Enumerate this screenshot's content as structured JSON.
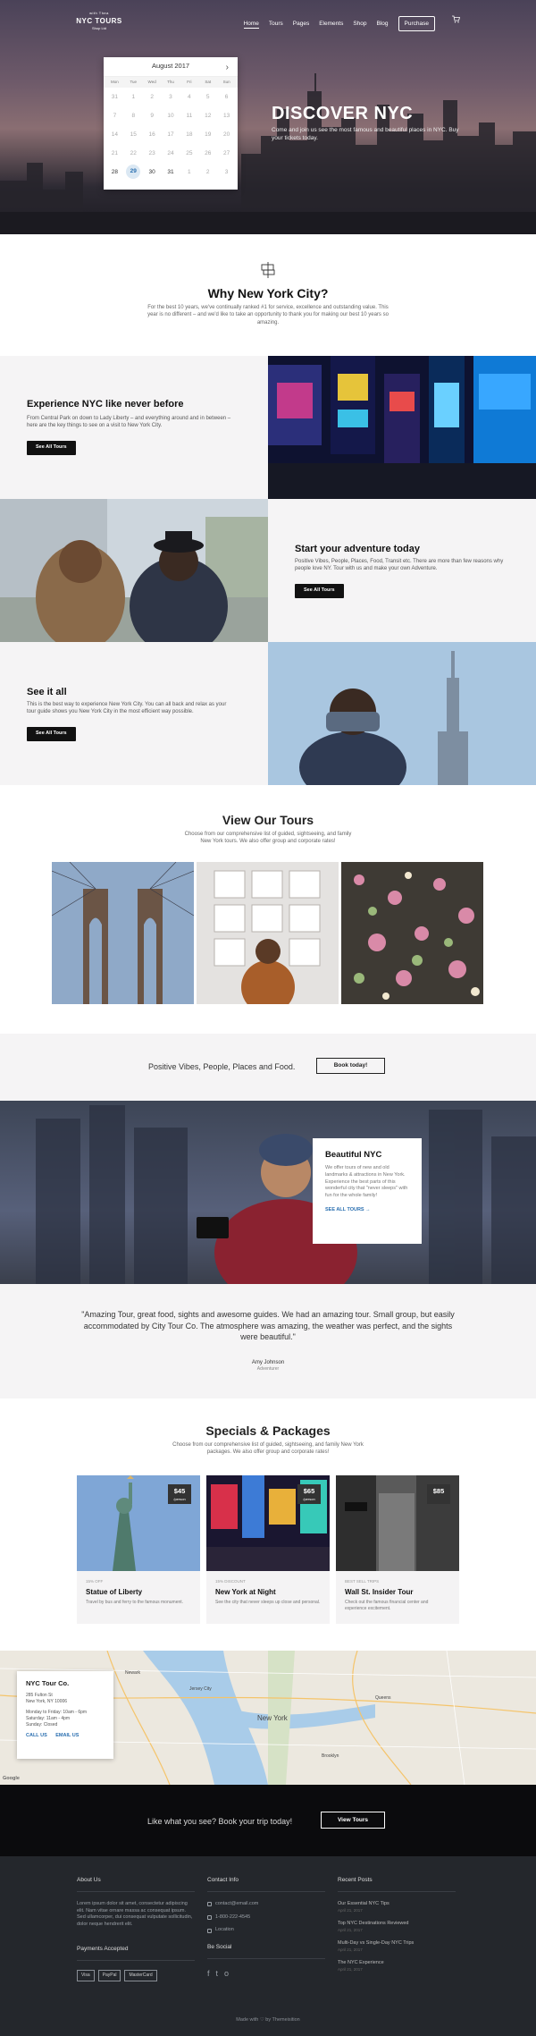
{
  "nav": {
    "logo_top": "with Thea",
    "logo_main": "NYC TOURS",
    "logo_sub": "Shop Ltd",
    "items": [
      "Home",
      "Tours",
      "Pages",
      "Elements",
      "Shop",
      "Blog"
    ],
    "purchase": "Purchase"
  },
  "calendar": {
    "month": "August 2017",
    "days": [
      "Mon",
      "Tue",
      "Wed",
      "Thu",
      "Fri",
      "Sat",
      "Sun"
    ],
    "cells": [
      "31",
      "1",
      "2",
      "3",
      "4",
      "5",
      "6",
      "7",
      "8",
      "9",
      "10",
      "11",
      "12",
      "13",
      "14",
      "15",
      "16",
      "17",
      "18",
      "19",
      "20",
      "21",
      "22",
      "23",
      "24",
      "25",
      "26",
      "27",
      "28",
      "29",
      "30",
      "31",
      "1",
      "2",
      "3"
    ],
    "selected": "29"
  },
  "hero": {
    "title": "DISCOVER NYC",
    "subtitle": "Come and join us see the most famous and beautiful places in NYC. Buy your tickets today."
  },
  "why": {
    "title": "Why New York City?",
    "text": "For the best 10 years, we've continually ranked #1 for service, excellence and outstanding value. This year is no different – and we'd like to take an opportunity to thank you for making our best 10 years so amazing."
  },
  "sections": [
    {
      "title": "Experience NYC like never before",
      "text": "From Central Park on down to Lady Liberty – and everything around and in between – here are the key things to see on a visit to New York City.",
      "button": "See All Tours"
    },
    {
      "title": "Start your adventure today",
      "text": "Positive Vibes, People, Places, Food, Transit etc. There are more than few reasons why people love NY. Tour with us and make your own Adventure.",
      "button": "See All Tours"
    },
    {
      "title": "See it all",
      "text": "This is the best way to experience New York City. You can all back and relax as your tour guide shows you New York City in the most efficient way possible.",
      "button": "See All Tours"
    }
  ],
  "tours": {
    "title": "View Our Tours",
    "text": "Choose from our comprehensive list of guided, sightseeing, and family New York tours. We also offer group and corporate rates!"
  },
  "vibes": {
    "text": "Positive Vibes, People, Places and Food.",
    "button": "Book today!"
  },
  "beautiful": {
    "title": "Beautiful NYC",
    "text": "We offer tours of new and old landmarks & attractions in New York. Experience the best parts of this wonderful city that \"never sleeps\" with fun for the whole family!",
    "link": "SEE ALL TOURS"
  },
  "testimonial": {
    "quote": "\"Amazing Tour, great food, sights and awesome guides. We had an amazing tour. Small group, but easily accommodated by City Tour Co. The atmosphere was amazing, the weather was perfect, and the sights were beautiful.\"",
    "name": "Amy Johnson",
    "role": "Adventurer"
  },
  "specials": {
    "title": "Specials & Packages",
    "text": "Choose from our comprehensive list of guided, sightseeing, and family New York packages. We also offer group and corporate rates!",
    "cards": [
      {
        "price": "$45",
        "per": "/person",
        "category": "15% OFF",
        "title": "Statue of Liberty",
        "text": "Travel by bus and ferry to the famous monument."
      },
      {
        "price": "$65",
        "per": "/person",
        "category": "15% DISCOUNT",
        "title": "New York at Night",
        "text": "See the city that never sleeps up close and personal."
      },
      {
        "price": "$85",
        "per": "",
        "category": "BEST SELL TRIPS",
        "title": "Wall St. Insider Tour",
        "text": "Check out the famous financial center and experience excitement."
      }
    ]
  },
  "map": {
    "title": "NYC Tour Co.",
    "address1": "285 Fulton St",
    "address2": "New York, NY 10006",
    "hours": [
      "Monday to Friday: 10am - 6pm",
      "Saturday: 11am - 4pm",
      "Sunday: Closed"
    ],
    "call": "CALL US",
    "email": "EMAIL US",
    "labels": [
      "Jersey City",
      "New York",
      "Newark",
      "Queens",
      "Brooklyn"
    ],
    "google": "Google"
  },
  "book": {
    "text": "Like what you see? Book your trip today!",
    "button": "View Tours"
  },
  "footer": {
    "about_title": "About Us",
    "about_text": "Lorem ipsum dolor sit amet, consectetur adipiscing elit. Nam vitae ornare massa ac consequat ipsum. Sed ullamcorper, dui consequat vulputate sollicitudin, dolor neque hendrerit elit.",
    "payments_title": "Payments Accepted",
    "payments": [
      "Visa",
      "PayPal",
      "MasterCard"
    ],
    "contact_title": "Contact Info",
    "contact": [
      "contact@email.com",
      "1-800-222-4545",
      "Location"
    ],
    "social_title": "Be Social",
    "social": [
      "f",
      "t",
      "o"
    ],
    "recent_title": "Recent Posts",
    "posts": [
      {
        "title": "Our Essential NYC Tips",
        "date": "April 21, 2017"
      },
      {
        "title": "Top NYC Destinations Reviewed",
        "date": "April 21, 2017"
      },
      {
        "title": "Multi-Day vs Single-Day NYC Trips",
        "date": "April 21, 2017"
      },
      {
        "title": "The NYC Experience",
        "date": "April 21, 2017"
      }
    ],
    "made_with": "Made with ♡ by Themeisition"
  }
}
